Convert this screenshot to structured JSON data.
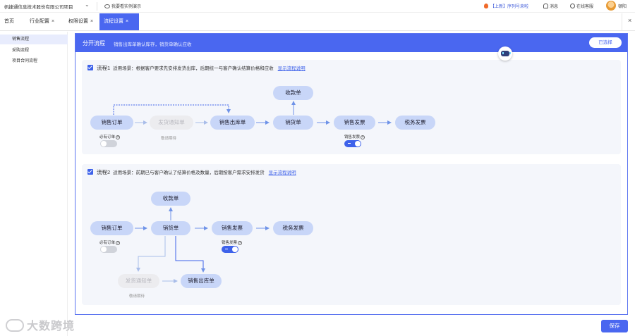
{
  "topbar": {
    "company": "帆捷通信息技术股份有限公司项目",
    "demo": "我要看实例演示",
    "upgrade": "【上新】序列号来啦",
    "messages": "消息",
    "service": "在线客服",
    "user": "顿阳"
  },
  "tabs": [
    {
      "label": "首页",
      "closable": false
    },
    {
      "label": "行业配置",
      "closable": true
    },
    {
      "label": "权限设置",
      "closable": true
    },
    {
      "label": "流程设置",
      "closable": true,
      "active": true
    }
  ],
  "tab_close_symbol": "×",
  "sidebar": {
    "items": [
      {
        "label": "销售流程",
        "active": true
      },
      {
        "label": "采购流程"
      },
      {
        "label": "项目合同流程"
      }
    ]
  },
  "panel": {
    "title": "分开流程",
    "desc": "销售出库单确认库存，销货单确认应收",
    "selected_label": "已选择"
  },
  "flow1": {
    "name": "流程1",
    "scene": "适用场景：根据客户要求先安排发货出库，后期统一与客户确认结算价格和应收",
    "link": "显示流程说明",
    "nodes": {
      "order": "销售订单",
      "notice": "发货通知单",
      "outbound": "销售出库单",
      "receipt": "收款单",
      "sales": "销货单",
      "invoice": "销售发票",
      "tax": "税务发票"
    },
    "order_required": "必有订单",
    "notice_note": "敬请期待",
    "invoice_label": "销售发票",
    "order_required_on": false,
    "invoice_on": true
  },
  "flow2": {
    "name": "流程2",
    "scene": "适用场景：前期已与客户确认了结算价格及数量，后期按客户需求安排发货",
    "link": "显示流程说明",
    "nodes": {
      "order": "销售订单",
      "sales": "销货单",
      "receipt": "收款单",
      "invoice": "销售发票",
      "tax": "税务发票",
      "notice": "发货通知单",
      "outbound": "销售出库单"
    },
    "order_required": "必有订单",
    "notice_note": "敬请期待",
    "invoice_label": "销售发票",
    "order_required_on": false,
    "invoice_on": true
  },
  "save_label": "保存",
  "watermark": "大数跨境",
  "colors": {
    "accent": "#4a67f0",
    "node": "#c8d6f8",
    "arrow": "#6f93e8"
  }
}
